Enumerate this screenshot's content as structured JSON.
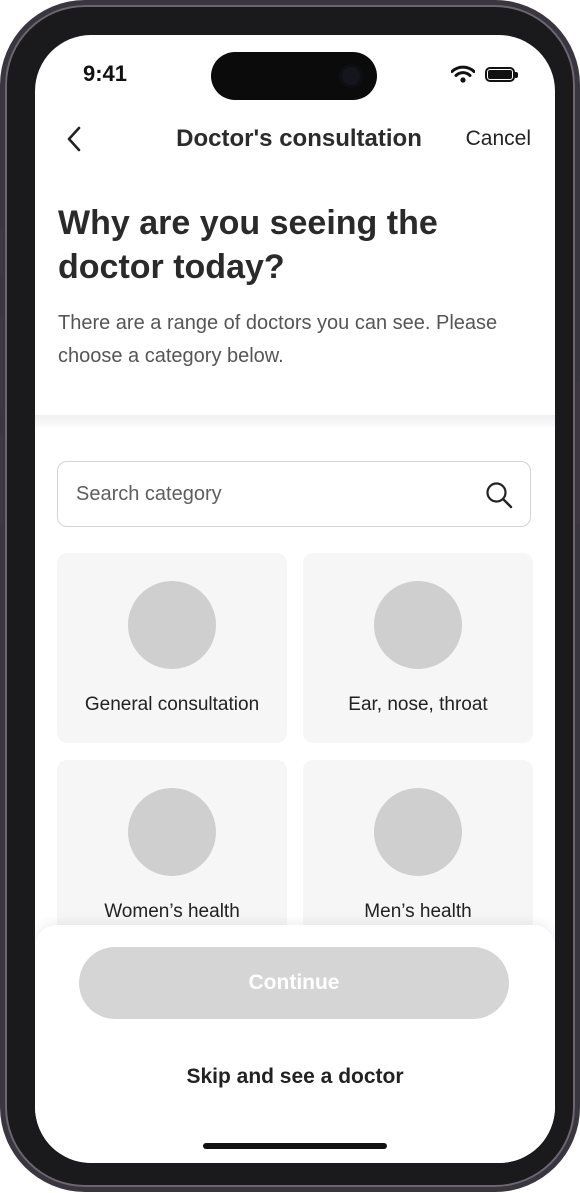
{
  "status_bar": {
    "time": "9:41"
  },
  "nav": {
    "title": "Doctor's consultation",
    "cancel_label": "Cancel"
  },
  "heading": "Why are you seeing the doctor today?",
  "subtext": "There are a range of doctors you can see. Please choose a category below.",
  "search": {
    "placeholder": "Search category",
    "value": ""
  },
  "categories": [
    {
      "label": "General consultation"
    },
    {
      "label": "Ear, nose, throat"
    },
    {
      "label": "Women’s health"
    },
    {
      "label": "Men’s health"
    }
  ],
  "footer": {
    "continue_label": "Continue",
    "skip_label": "Skip and see a doctor"
  },
  "colors": {
    "disabled_button": "#d5d5d5",
    "card_bg": "#f6f6f6",
    "placeholder_circle": "#cfcfcf"
  }
}
